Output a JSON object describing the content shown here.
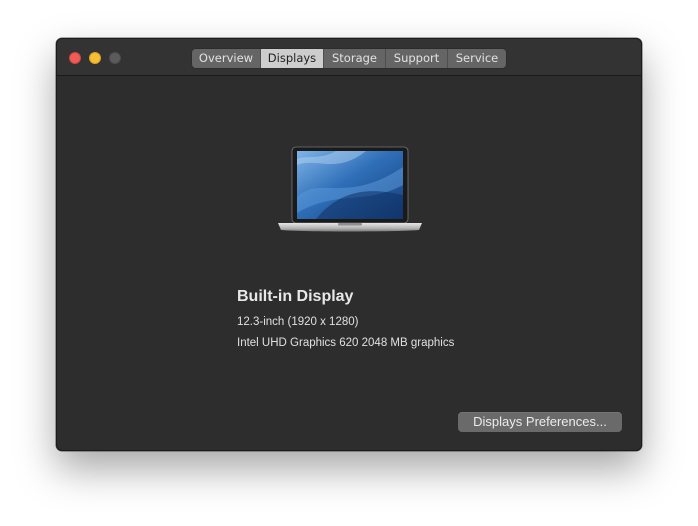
{
  "window": {
    "tabs": [
      {
        "label": "Overview",
        "active": false
      },
      {
        "label": "Displays",
        "active": true
      },
      {
        "label": "Storage",
        "active": false
      },
      {
        "label": "Support",
        "active": false
      },
      {
        "label": "Service",
        "active": false
      }
    ],
    "colors": {
      "close": "#ee5c57",
      "minimize": "#f6be32",
      "zoom": "#5b5b5b",
      "background": "#2d2d2d"
    }
  },
  "display": {
    "image_icon": "macbook-laptop-icon",
    "title": "Built-in Display",
    "resolution": "12.3-inch (1920 x 1280)",
    "graphics": "Intel UHD Graphics 620 2048 MB graphics"
  },
  "actions": {
    "preferences_label": "Displays Preferences..."
  }
}
